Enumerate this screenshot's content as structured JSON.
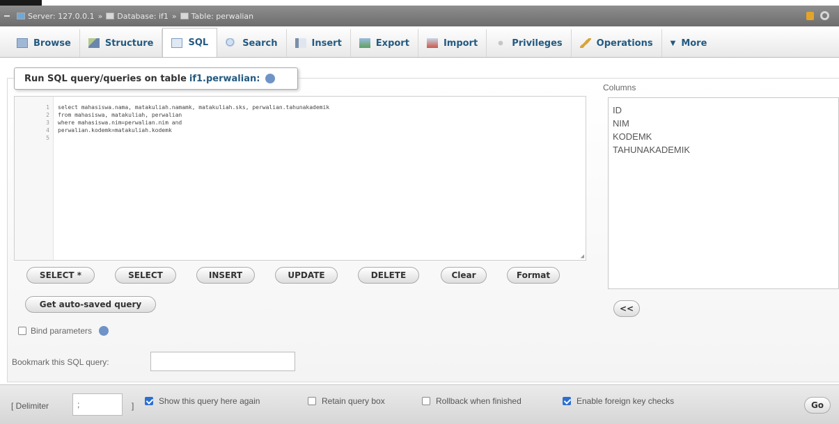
{
  "breadcrumb": {
    "server": "Server: 127.0.0.1",
    "database": "Database: if1",
    "table": "Table: perwalian",
    "separator": "»"
  },
  "tabs": [
    {
      "label": "Browse",
      "icon": "browse-icon",
      "active": false
    },
    {
      "label": "Structure",
      "icon": "structure-icon",
      "active": false
    },
    {
      "label": "SQL",
      "icon": "sql-icon",
      "active": true
    },
    {
      "label": "Search",
      "icon": "search-icon",
      "active": false
    },
    {
      "label": "Insert",
      "icon": "insert-icon",
      "active": false
    },
    {
      "label": "Export",
      "icon": "export-icon",
      "active": false
    },
    {
      "label": "Import",
      "icon": "import-icon",
      "active": false
    },
    {
      "label": "Privileges",
      "icon": "privileges-icon",
      "active": false
    },
    {
      "label": "Operations",
      "icon": "operations-icon",
      "active": false
    },
    {
      "label": "More",
      "icon": "caret-down-icon",
      "active": false
    }
  ],
  "legend": {
    "text": "Run SQL query/queries on table",
    "table": "if1.perwalian:"
  },
  "editor": {
    "line_numbers": [
      "1",
      "2",
      "3",
      "4",
      "5"
    ],
    "lines": [
      "select mahasiswa.nama, matakuliah.namamk, matakuliah.sks, perwalian.tahunakademik",
      "from mahasiswa, matakuliah, perwalian",
      "where mahasiswa.nim=perwalian.nim and",
      "perwalian.kodemk=matakuliah.kodemk",
      ""
    ]
  },
  "columns": {
    "label": "Columns",
    "items": [
      "ID",
      "NIM",
      "KODEMK",
      "TAHUNAKADEMIK"
    ]
  },
  "buttons": {
    "select_star": "SELECT *",
    "select": "SELECT",
    "insert": "INSERT",
    "update": "UPDATE",
    "delete": "DELETE",
    "clear": "Clear",
    "format": "Format",
    "get_auto_saved": "Get auto-saved query",
    "insert_column": "<<",
    "go": "Go"
  },
  "bind_parameters": {
    "label": "Bind parameters",
    "checked": false
  },
  "bookmark": {
    "label": "Bookmark this SQL query:",
    "value": ""
  },
  "bottom": {
    "delimiter_open": "[ Delimiter",
    "delimiter_value": ";",
    "delimiter_close": "]",
    "show_query": {
      "label": "Show this query here again",
      "checked": true
    },
    "retain_box": {
      "label": "Retain query box",
      "checked": false
    },
    "rollback": {
      "label": "Rollback when finished",
      "checked": false
    },
    "foreign_keys": {
      "label": "Enable foreign key checks",
      "checked": true
    }
  },
  "colors": {
    "accent": "#235a81",
    "checkbox_on": "#2c6fd1"
  }
}
